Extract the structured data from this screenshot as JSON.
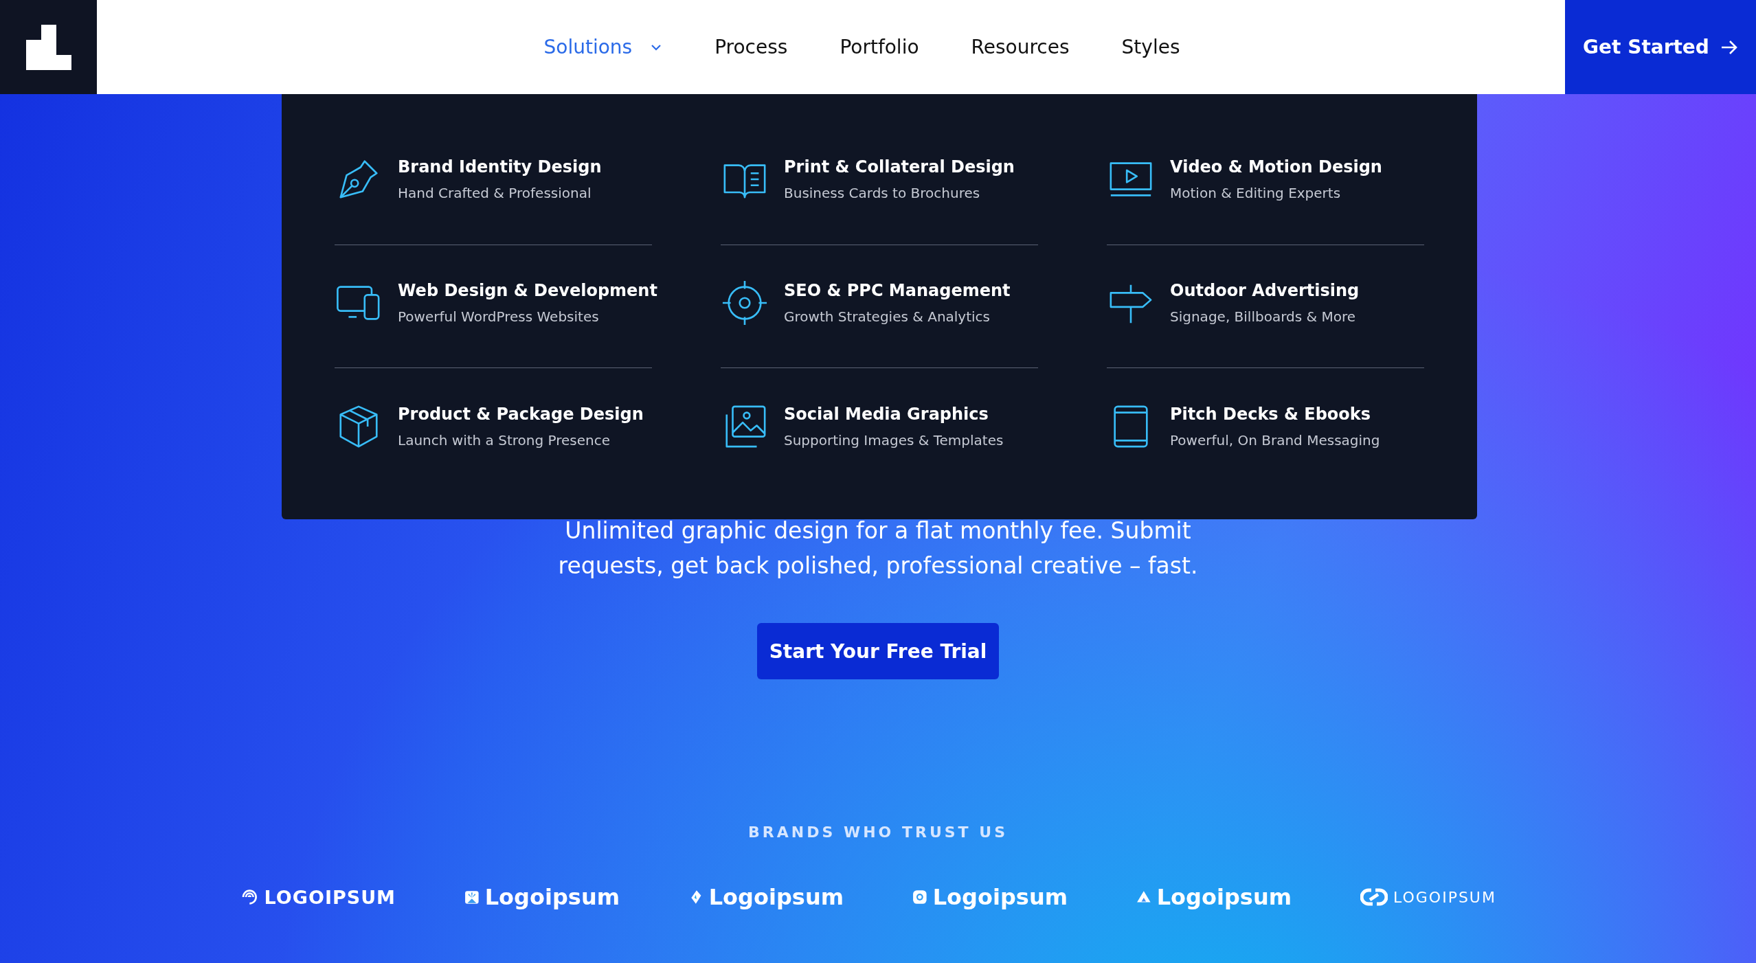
{
  "header": {
    "nav": [
      {
        "label": "Solutions",
        "selected": true,
        "dropdown": true
      },
      {
        "label": "Process",
        "selected": false,
        "dropdown": false
      },
      {
        "label": "Portfolio",
        "selected": false,
        "dropdown": false
      },
      {
        "label": "Resources",
        "selected": false,
        "dropdown": false
      },
      {
        "label": "Styles",
        "selected": false,
        "dropdown": false
      }
    ],
    "cta": "Get Started"
  },
  "menu": {
    "items": [
      {
        "kind": "pen",
        "title": "Brand Identity Design",
        "subtitle": "Hand Crafted & Professional"
      },
      {
        "kind": "book",
        "title": "Print & Collateral Design",
        "subtitle": "Business Cards to Brochures"
      },
      {
        "kind": "video",
        "title": "Video & Motion Design",
        "subtitle": "Motion & Editing Experts"
      },
      {
        "kind": "devices",
        "title": "Web Design & Development",
        "subtitle": "Powerful WordPress Websites"
      },
      {
        "kind": "target",
        "title": "SEO & PPC Management",
        "subtitle": "Growth Strategies & Analytics"
      },
      {
        "kind": "sign",
        "title": "Outdoor Advertising",
        "subtitle": "Signage, Billboards & More"
      },
      {
        "kind": "box",
        "title": "Product & Package Design",
        "subtitle": "Launch with a Strong Presence"
      },
      {
        "kind": "image",
        "title": "Social Media Graphics",
        "subtitle": "Supporting Images & Templates"
      },
      {
        "kind": "tablet",
        "title": "Pitch Decks & Ebooks",
        "subtitle": "Powerful, On Brand Messaging"
      }
    ]
  },
  "hero": {
    "text": "Unlimited graphic design for a flat monthly fee. Submit requests, get back polished, professional creative – fast.",
    "button": "Start Your Free Trial"
  },
  "brands": {
    "heading": "BRANDS WHO TRUST US",
    "logos": [
      {
        "kind": "swirl",
        "name": "LOGOIPSUM"
      },
      {
        "kind": "burst",
        "name": "Logoipsum"
      },
      {
        "kind": "diamond",
        "name": "Logoipsum"
      },
      {
        "kind": "ring",
        "name": "Logoipsum"
      },
      {
        "kind": "triangle",
        "name": "Logoipsum"
      },
      {
        "kind": "link",
        "name": "LOGOIPSUM"
      }
    ]
  }
}
